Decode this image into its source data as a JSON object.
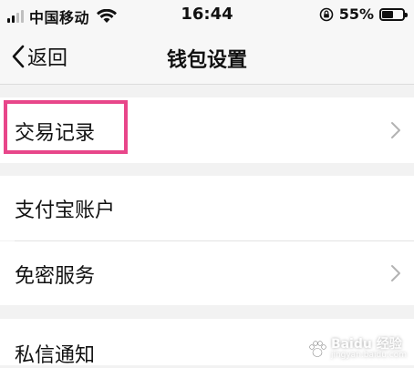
{
  "status_bar": {
    "carrier": "中国移动",
    "time": "16:44",
    "battery_percent": "55%",
    "battery_level": 0.55
  },
  "nav": {
    "back_label": "返回",
    "title": "钱包设置"
  },
  "settings": {
    "transaction_records": "交易记录",
    "alipay_account": "支付宝账户",
    "password_free": "免密服务",
    "private_message": "私信通知"
  },
  "colors": {
    "highlight": "#e8468a",
    "background": "#f2f2f2"
  },
  "watermark": {
    "brand": "Baidu 经验",
    "url": "jingyan.baidu.com"
  }
}
